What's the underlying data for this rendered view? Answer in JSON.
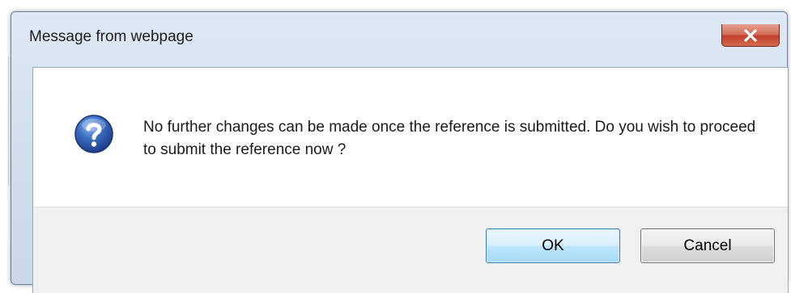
{
  "dialog": {
    "title": "Message from webpage",
    "message": "No further changes can be made once the reference is submitted. Do you wish to proceed to submit the reference now ?",
    "icon": "question-icon",
    "buttons": {
      "ok_label": "OK",
      "cancel_label": "Cancel"
    },
    "close_icon": "close-icon"
  },
  "colors": {
    "close_button": "#c1412c",
    "ok_button_border": "#3c7fb1",
    "icon_blue": "#2f5fb3",
    "button_bar": "#f0f0f0"
  }
}
